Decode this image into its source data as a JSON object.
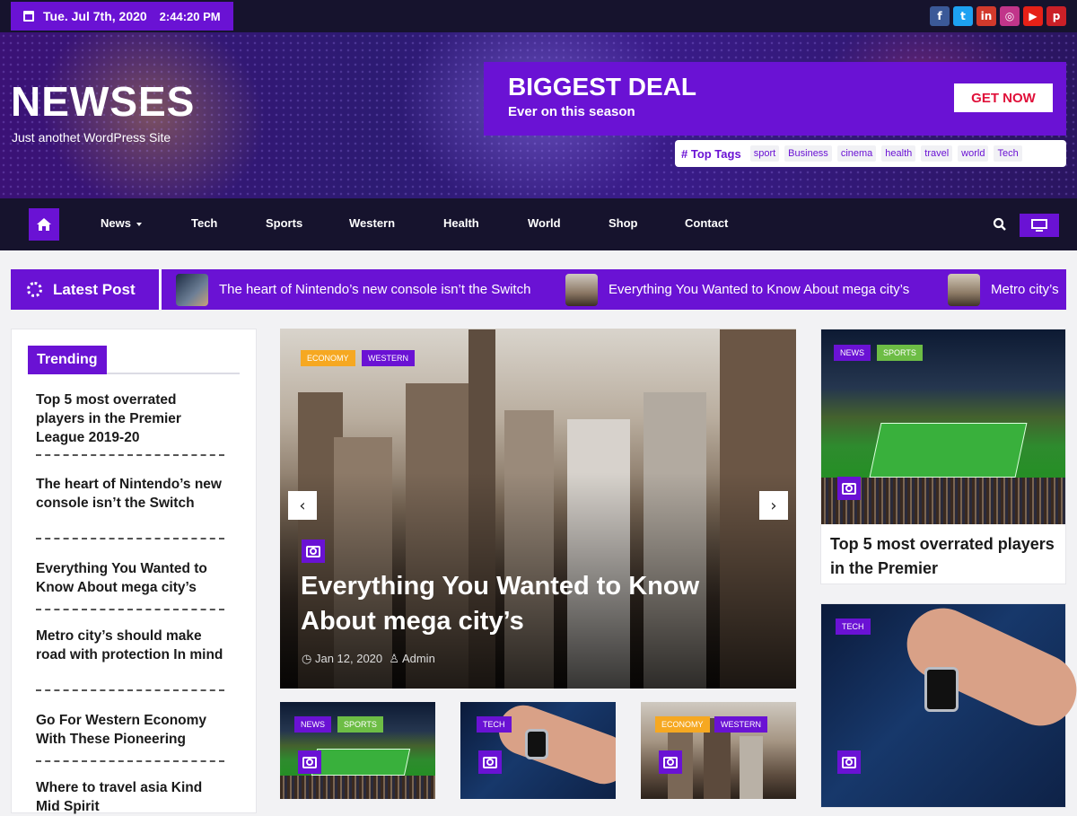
{
  "topbar": {
    "date": "Tue. Jul 7th, 2020",
    "time": "2:44:20 PM",
    "socials": [
      {
        "icon": "facebook-icon",
        "glyph": "f",
        "color": "#3b5998"
      },
      {
        "icon": "twitter-icon",
        "glyph": "t",
        "color": "#1da1f2"
      },
      {
        "icon": "linkedin-icon",
        "glyph": "in",
        "color": "#d23a2c"
      },
      {
        "icon": "instagram-icon",
        "glyph": "◎",
        "color": "#c1358a"
      },
      {
        "icon": "youtube-icon",
        "glyph": "▶",
        "color": "#e62117"
      },
      {
        "icon": "pinterest-icon",
        "glyph": "p",
        "color": "#cb2027"
      }
    ]
  },
  "header": {
    "site_title": "NEWSES",
    "site_description": "Just anothet WordPress Site",
    "deal": {
      "title": "BIGGEST DEAL",
      "subtitle": "Ever on this season",
      "button": "GET NOW"
    },
    "top_tags_label": "# Top Tags",
    "tags": [
      "sport",
      "Business",
      "cinema",
      "health",
      "travel",
      "world",
      "Tech"
    ]
  },
  "nav": {
    "items": [
      "News",
      "Tech",
      "Sports",
      "Western",
      "Health",
      "World",
      "Shop",
      "Contact"
    ]
  },
  "ticker": {
    "label": "Latest Post",
    "items": [
      "The heart of Nintendo’s new console isn’t the Switch",
      "Everything You Wanted to Know About mega city’s",
      "Metro city’s"
    ]
  },
  "trending": {
    "heading": "Trending",
    "items": [
      "Top 5 most overrated players in the Premier League 2019-20",
      "The heart of Nintendo’s new console isn’t the Switch",
      "Everything You Wanted to Know About mega city’s",
      "Metro city’s should make road with protection In mind",
      "Go For Western Economy With These Pioneering",
      "Where to travel asia Kind Mid Spirit"
    ]
  },
  "hero": {
    "badges": [
      "ECONOMY",
      "WESTERN"
    ],
    "title": "Everything You Wanted to Know About mega city’s",
    "date": "Jan 12, 2020",
    "author": "Admin"
  },
  "right_cards": [
    {
      "badges": [
        "NEWS",
        "SPORTS"
      ],
      "title": "Top 5 most overrated players in the Premier"
    },
    {
      "badges": [
        "TECH"
      ]
    }
  ],
  "small_cards": [
    {
      "badges": [
        "NEWS",
        "SPORTS"
      ]
    },
    {
      "badges": [
        "TECH"
      ]
    },
    {
      "badges": [
        "ECONOMY",
        "WESTERN"
      ]
    }
  ],
  "colors": {
    "accent": "#6a12d4",
    "dark": "#16132d",
    "deal_button_text": "#e0103a",
    "badge_yellow": "#f6a821",
    "badge_green": "#6dbd45"
  }
}
